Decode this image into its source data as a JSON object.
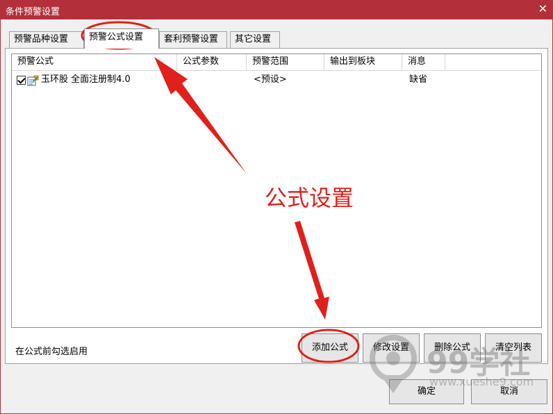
{
  "window": {
    "title": "条件预警设置",
    "close_glyph": "✕"
  },
  "tabs": [
    {
      "label": "预警品种设置",
      "active": false
    },
    {
      "label": "预警公式设置",
      "active": true
    },
    {
      "label": "套利预警设置",
      "active": false
    },
    {
      "label": "其它设置",
      "active": false
    }
  ],
  "list": {
    "columns": [
      "预警公式",
      "公式参数",
      "预警范围",
      "输出到板块",
      "消息"
    ],
    "rows": [
      {
        "checked": true,
        "formula": "玉环股 全面注册制4.0",
        "params": "",
        "range": "<预设>",
        "output": "",
        "message": "缺省"
      }
    ]
  },
  "hint": "在公式前勾选启用",
  "buttons": {
    "add": "添加公式",
    "modify": "修改设置",
    "delete": "删除公式",
    "clear": "清空列表",
    "ok": "确定",
    "cancel": "取消"
  },
  "annotation": {
    "text": "公式设置",
    "color": "#e0201c"
  },
  "watermark": {
    "brand": "99学社",
    "url": "www.xueshe9.com"
  }
}
